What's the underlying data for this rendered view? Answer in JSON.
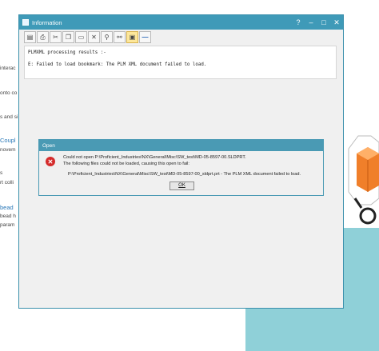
{
  "background": {
    "lines": [
      "interac",
      "onto co",
      "s and si"
    ],
    "links": [
      "Coupl",
      "bead"
    ],
    "line_movem": "novem",
    "line_s": "s",
    "line_rt": "rt colli",
    "line_bead": "bead h",
    "line_param": "param"
  },
  "info_window": {
    "title": "Information",
    "controls": {
      "help": "?",
      "minimize": "–",
      "maximize": "□",
      "close": "✕"
    },
    "toolbar": [
      "print-preview",
      "print",
      "cut",
      "copy",
      "paste",
      "clear",
      "find",
      "find-next",
      "save",
      "collapse"
    ],
    "results_line1": "PLMXML processing results :-",
    "results_line2": "E: Failed to load bookmark: The PLM XML document failed to load."
  },
  "open_dialog": {
    "title": "Open",
    "line1": "Could not open P:\\Proficient_Industries\\NX\\General\\Misc\\SW_test\\MD-05-8597-00.SLDPRT.",
    "line2": "The following files could not be loaded, causing this open to fail:",
    "line3": "P:\\Proficient_Industries\\NX\\General\\Misc\\SW_test\\MD-05-8597-00_sldprt.prt - The PLM XML document failed to load.",
    "ok_label": "OK"
  }
}
